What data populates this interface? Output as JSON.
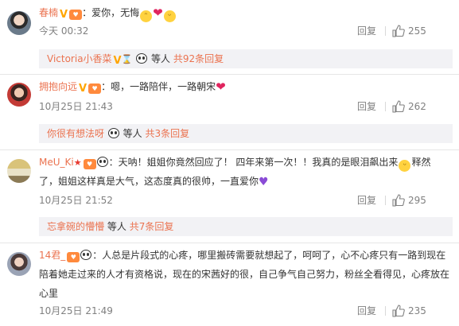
{
  "comments": [
    {
      "user": "春楠",
      "text_pre": "：爱你，无悔",
      "time": "今天 00:32",
      "reply_label": "回复",
      "likes": "255",
      "reply_summary": {
        "who": "Victoria小香菜",
        "mid": "等人",
        "more": "共92条回复"
      }
    },
    {
      "user": "拥抱向远",
      "text_pre": "：嗯，一路陪伴，一路朝宋",
      "time": "10月25日 21:43",
      "reply_label": "回复",
      "likes": "262",
      "reply_summary": {
        "who": "你很有想法呀",
        "mid": "等人",
        "more": "共3条回复"
      }
    },
    {
      "user": "MeU_Ki",
      "text_line1": "：天呐！姐姐你竟然回应了！ 四年来第一次！！我真的是眼泪飙出来",
      "text_line1_end": "释然",
      "text_line2": "了，姐姐这样真是大气，这态度真的很帅，一直爱你",
      "time": "10月25日 21:52",
      "reply_label": "回复",
      "likes": "295",
      "reply_summary": {
        "who": "忘拿碗的懵懵",
        "mid": "等人",
        "more": "共7条回复"
      }
    },
    {
      "user": "14君_",
      "text_line1": "：人总是片段式的心疼，哪里搬砖需要就想起了，呵呵了，心不心疼只有一路到现在",
      "text_line2": "陪着她走过来的人才有资格说，现在的宋茜好的很，自己争气自己努力，粉丝全看得见，心疼放在",
      "text_line3": "心里",
      "time": "10月25日 21:49",
      "reply_label": "回复",
      "likes": "235"
    }
  ],
  "colors": {
    "username": "#eb7350",
    "meta": "#808080",
    "reply_bg": "#f2f2f5"
  }
}
